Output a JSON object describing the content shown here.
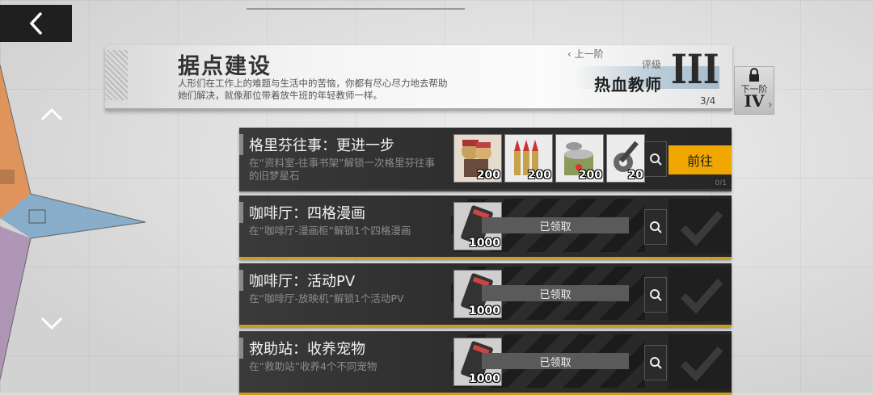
{
  "header": {
    "title": "据点建设",
    "description": "人形们在工作上的难题与生活中的苦恼，你都有尽心尽力地去帮助她们解决，就像那位带着放牛班的年轻教师一样。",
    "prev_label": "上一阶",
    "rank_label": "评级",
    "rank_name": "热血教师",
    "rank_roman": "III",
    "progress": "3/4"
  },
  "next_tier": {
    "label": "下一阶",
    "roman": "IV"
  },
  "tasks": [
    {
      "title": "格里芬往事：更进一步",
      "description": "在“资料室-往事书架”解锁一次格里芬往事的旧梦星石",
      "rewards": [
        {
          "icon": "chibi-doll-icon",
          "qty": "200"
        },
        {
          "icon": "ammo-icon",
          "qty": "200"
        },
        {
          "icon": "ration-icon",
          "qty": "200"
        },
        {
          "icon": "parts-icon",
          "qty": "20"
        }
      ],
      "action": "前往",
      "count": "0/1"
    },
    {
      "title": "咖啡厅：四格漫画",
      "description": "在“咖啡厅-漫画柜”解锁1个四格漫画",
      "reward": {
        "icon": "phone-icon",
        "qty": "1000"
      },
      "status": "已领取"
    },
    {
      "title": "咖啡厅：活动PV",
      "description": "在“咖啡厅-放映机”解锁1个活动PV",
      "reward": {
        "icon": "phone-icon",
        "qty": "1000"
      },
      "status": "已领取"
    },
    {
      "title": "救助站：收养宠物",
      "description": "在“救助站”收养4个不同宠物",
      "reward": {
        "icon": "phone-icon",
        "qty": "1000"
      },
      "status": "已领取"
    }
  ],
  "colors": {
    "accent": "#f0a800",
    "claimed_border": "#c79e1e",
    "panel": "#2f2f2f"
  }
}
